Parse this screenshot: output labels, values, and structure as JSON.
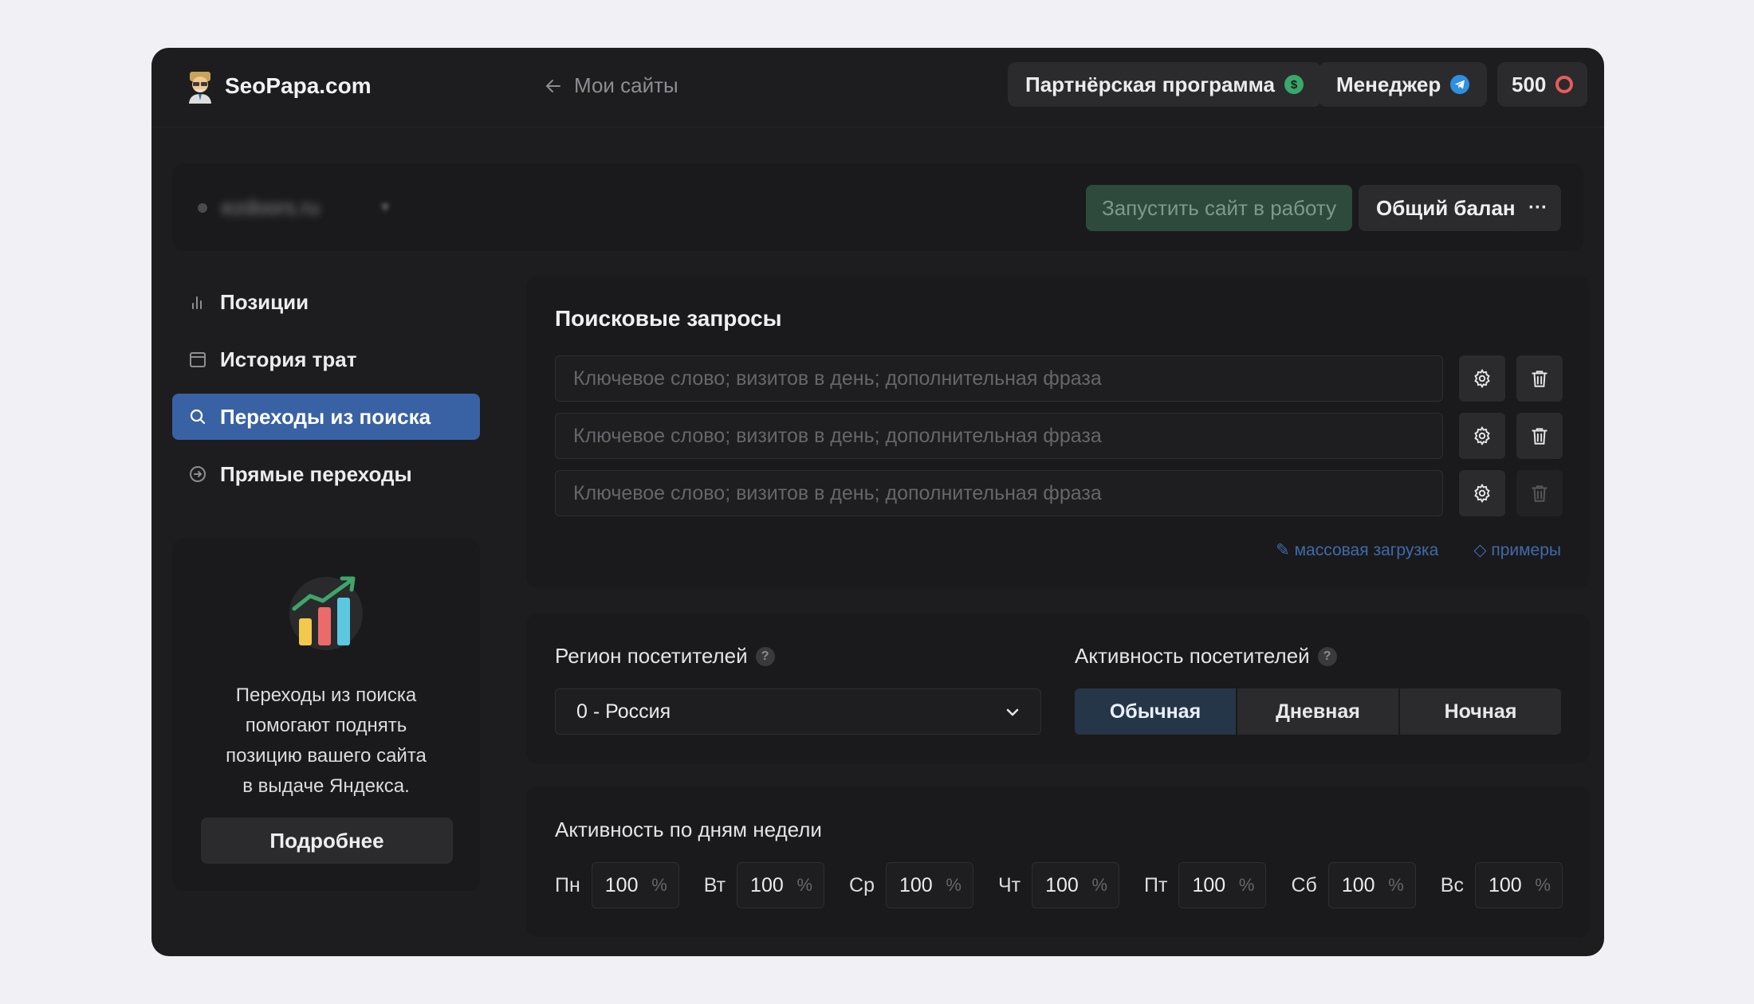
{
  "header": {
    "brand": "SeoPapa.com",
    "back_label": "Мои сайты",
    "partner_label": "Партнёрская программа",
    "manager_label": "Менеджер",
    "balance_value": "500"
  },
  "site": {
    "name": "ezdoors.ru",
    "launch_label": "Запустить сайт в работу",
    "balance_label": "Общий баланс",
    "more_label": "···"
  },
  "nav": {
    "items": [
      {
        "label": "Позиции"
      },
      {
        "label": "История трат"
      },
      {
        "label": "Переходы из поиска"
      },
      {
        "label": "Прямые переходы"
      }
    ]
  },
  "promo": {
    "line1": "Переходы из поиска",
    "line2": "помогают поднять",
    "line3": "позицию вашего сайта",
    "line4": "в выдаче Яндекса.",
    "button_label": "Подробнее"
  },
  "queries": {
    "title": "Поисковые запросы",
    "placeholder": "Ключевое слово; визитов в день; дополнительная фраза",
    "bulk_label": "массовая загрузка",
    "examples_label": "примеры"
  },
  "region": {
    "label": "Регион посетителей",
    "value": "0 - Россия"
  },
  "activity": {
    "label": "Активность посетителей",
    "options": [
      "Обычная",
      "Дневная",
      "Ночная"
    ],
    "selected": "Обычная"
  },
  "week": {
    "title": "Активность по дням недели",
    "percent_sign": "%",
    "days": [
      {
        "label": "Пн",
        "value": "100"
      },
      {
        "label": "Вт",
        "value": "100"
      },
      {
        "label": "Ср",
        "value": "100"
      },
      {
        "label": "Чт",
        "value": "100"
      },
      {
        "label": "Пт",
        "value": "100"
      },
      {
        "label": "Сб",
        "value": "100"
      },
      {
        "label": "Вс",
        "value": "100"
      }
    ]
  },
  "colors": {
    "accent": "#3962a4",
    "launch_bg": "#2e4a3d",
    "partner_badge": "#3aa86b",
    "manager_badge": "#2f8fe0",
    "balance_badge": "#e85c5c"
  }
}
